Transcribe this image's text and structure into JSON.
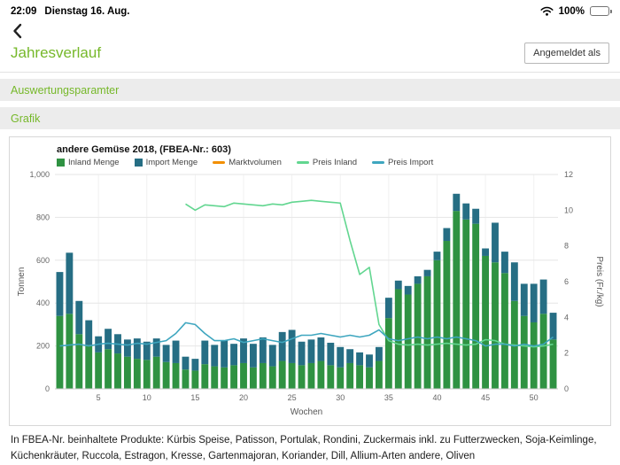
{
  "status_bar": {
    "time": "22:09",
    "date": "Dienstag 16. Aug.",
    "battery": "100%"
  },
  "header": {
    "title": "Jahresverlauf",
    "login_button": "Angemeldet als"
  },
  "sections": {
    "parameters": "Auswertungsparamter",
    "chart": "Grafik"
  },
  "footer": {
    "products": "In FBEA-Nr. beinhaltete Produkte: Kürbis Speise, Patisson, Portulak, Rondini, Zuckermais inkl. zu Futterzwecken, Soja-Keimlinge, Küchenkräuter, Ruccola, Estragon, Kresse, Gartenmajoran, Koriander, Dill, Allium-Arten andere, Oliven"
  },
  "chart_data": {
    "type": "bar",
    "subtype": "stacked-bars-with-price-lines",
    "title": "andere Gemüse 2018, (FBEA-Nr.: 603)",
    "xlabel": "Wochen",
    "ylabel_left": "Tonnen",
    "ylabel_right": "Preis (Fr./kg)",
    "ylim_left": [
      0,
      1000
    ],
    "ylim_right": [
      0,
      12
    ],
    "y_ticks_left": [
      0,
      200,
      400,
      600,
      800,
      1000
    ],
    "y_ticks_left_labels": [
      "0",
      "200",
      "400",
      "600",
      "800",
      "1,000"
    ],
    "y_ticks_right": [
      0,
      2,
      4,
      6,
      8,
      10,
      12
    ],
    "x_ticks": [
      5,
      10,
      15,
      20,
      25,
      30,
      35,
      40,
      45,
      50
    ],
    "weeks": 52,
    "grid": true,
    "legend_position": "top-left",
    "series": [
      {
        "name": "Inland Menge",
        "type": "bar",
        "axis": "left",
        "color": "#2f9242",
        "values": [
          340,
          350,
          255,
          205,
          170,
          185,
          165,
          150,
          140,
          135,
          150,
          125,
          120,
          90,
          85,
          115,
          105,
          100,
          110,
          120,
          100,
          120,
          105,
          130,
          120,
          110,
          120,
          130,
          110,
          100,
          120,
          110,
          100,
          130,
          330,
          465,
          440,
          490,
          525,
          600,
          690,
          830,
          790,
          770,
          620,
          590,
          540,
          410,
          340,
          310,
          350,
          230
        ]
      },
      {
        "name": "Import Menge",
        "type": "bar",
        "axis": "left",
        "color": "#266e84",
        "values": [
          205,
          285,
          155,
          115,
          75,
          95,
          90,
          80,
          95,
          85,
          85,
          80,
          105,
          60,
          55,
          110,
          100,
          125,
          100,
          115,
          110,
          120,
          100,
          135,
          155,
          110,
          110,
          110,
          105,
          95,
          65,
          60,
          60,
          65,
          95,
          40,
          40,
          35,
          30,
          40,
          60,
          80,
          75,
          70,
          35,
          185,
          100,
          180,
          150,
          180,
          160,
          125
        ]
      },
      {
        "name": "Marktvolumen",
        "type": "line",
        "axis": "left",
        "color": "#f28f00",
        "values": []
      },
      {
        "name": "Preis Inland",
        "type": "line",
        "axis": "right",
        "color": "#62d690",
        "values": [
          null,
          null,
          null,
          null,
          null,
          null,
          null,
          null,
          null,
          null,
          null,
          null,
          null,
          10.35,
          10.0,
          10.3,
          10.25,
          10.2,
          10.4,
          10.35,
          10.3,
          10.25,
          10.35,
          10.3,
          10.45,
          10.5,
          10.55,
          10.5,
          10.45,
          10.4,
          8.3,
          6.4,
          6.8,
          3.6,
          2.7,
          2.5,
          2.45,
          2.5,
          2.45,
          2.5,
          2.55,
          2.5,
          2.45,
          2.5,
          2.75,
          2.7,
          2.5,
          2.45,
          2.4,
          2.35,
          2.4,
          2.5
        ]
      },
      {
        "name": "Preis Import",
        "type": "line",
        "axis": "right",
        "color": "#3ea6bf",
        "values": [
          2.4,
          2.45,
          2.5,
          2.4,
          2.5,
          2.55,
          2.5,
          2.45,
          2.55,
          2.5,
          2.6,
          2.7,
          3.1,
          3.7,
          3.6,
          3.1,
          2.7,
          2.7,
          2.8,
          2.6,
          2.7,
          2.8,
          2.7,
          2.6,
          2.8,
          3.0,
          3.0,
          3.1,
          3.0,
          2.9,
          3.0,
          2.9,
          3.0,
          3.3,
          2.8,
          2.7,
          2.8,
          2.9,
          2.8,
          2.9,
          2.8,
          2.9,
          2.8,
          2.7,
          2.4,
          2.5,
          2.5,
          2.4,
          2.5,
          2.4,
          2.5,
          2.9
        ]
      }
    ]
  }
}
